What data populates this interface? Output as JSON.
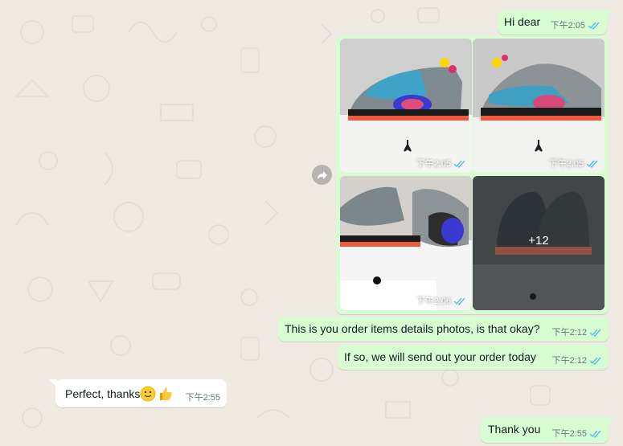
{
  "colors": {
    "outgoing": "#d9fdd3",
    "incoming": "#ffffff",
    "wallpaper": "#efeae2",
    "tick_read": "#53bdeb",
    "meta": "#667781"
  },
  "messages": [
    {
      "id": "m1",
      "text": "Hi dear",
      "time": "下午2:05",
      "status": "read"
    },
    {
      "id": "album",
      "photos": [
        {
          "time": "下午2:05",
          "status": "read"
        },
        {
          "time": "下午2:05",
          "status": "read"
        },
        {
          "time": "下午2:06",
          "status": "read"
        },
        {
          "overlay": "+12"
        }
      ],
      "forward_icon": "forward-arrow-icon"
    },
    {
      "id": "m2",
      "text": "This is you order items details photos, is that okay?",
      "time": "下午2:12",
      "status": "read"
    },
    {
      "id": "m3",
      "text": "If so, we will send out your order today",
      "time": "下午2:12",
      "status": "read"
    },
    {
      "id": "m4",
      "text": "Perfect, thanks",
      "emoji": [
        "slightly-smiling-face-icon",
        "thumbs-up-icon"
      ],
      "time": "下午2:55",
      "direction": "incoming"
    },
    {
      "id": "m5",
      "text": "Thank you",
      "time": "下午2:55",
      "status": "read"
    }
  ]
}
